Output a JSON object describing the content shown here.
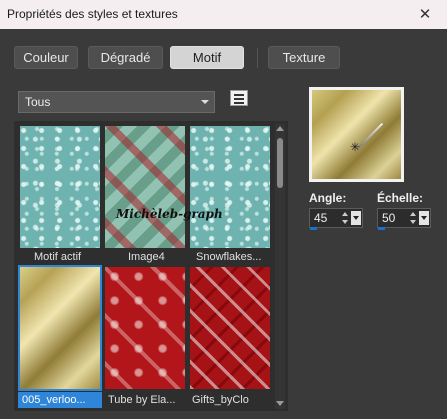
{
  "window": {
    "title": "Propriétés des styles et textures",
    "close_glyph": "✕"
  },
  "tabs": [
    {
      "label": "Couleur",
      "active": false
    },
    {
      "label": "Dégradé",
      "active": false
    },
    {
      "label": "Motif",
      "active": true
    },
    {
      "label": "Texture",
      "active": false
    }
  ],
  "category_select": {
    "value": "Tous"
  },
  "gallery": {
    "items": [
      {
        "name": "Motif actif",
        "texture": "teal-snowflakes",
        "selected": false
      },
      {
        "name": "Image4",
        "texture": "birds-diagonal",
        "selected": false
      },
      {
        "name": "Snowflakes...",
        "texture": "teal-snowflakes",
        "selected": false
      },
      {
        "name": "005_verloo...",
        "texture": "gold-gradient",
        "selected": true
      },
      {
        "name": "Tube by Ela...",
        "texture": "red-ornament",
        "selected": false
      },
      {
        "name": "Gifts_byClo",
        "texture": "red-gifts",
        "selected": false
      }
    ],
    "watermark": "Michèleb-graph"
  },
  "controls": {
    "angle_label": "Angle:",
    "angle_value": "45",
    "angle_level": 0.125,
    "scale_label": "Échelle:",
    "scale_value": "50",
    "scale_level": 0.125
  },
  "colors": {
    "accent": "#2f86d8",
    "slider_fill": "#1e6fc8"
  }
}
